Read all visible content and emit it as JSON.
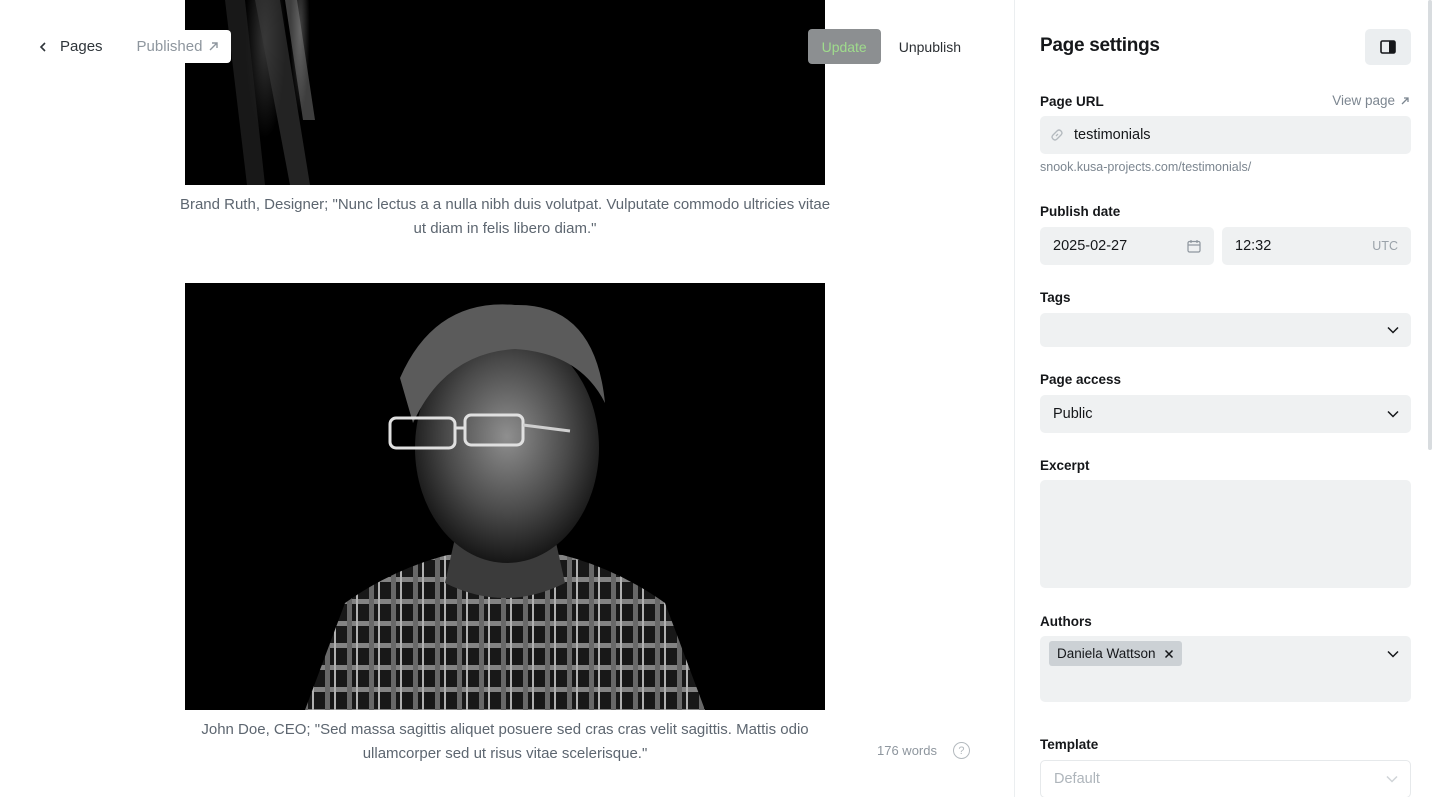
{
  "editor": {
    "back_label": "Pages",
    "status_label": "Published",
    "update_label": "Update",
    "unpublish_label": "Unpublish",
    "captions": [
      "Brand Ruth, Designer; \"Nunc lectus a a nulla nibh duis volutpat. Vulputate commodo ultricies vitae ut diam in felis libero diam.\"",
      "John Doe, CEO; \"Sed massa sagittis aliquet posuere sed cras cras velit sagittis. Mattis odio ullamcorper sed ut risus vitae scelerisque.\""
    ],
    "word_count": "176 words",
    "help_glyph": "?"
  },
  "settings": {
    "title": "Page settings",
    "url_label": "Page URL",
    "view_page_label": "View page",
    "url_value": "testimonials",
    "url_hint": "snook.kusa-projects.com/testimonials/",
    "publish_date_label": "Publish date",
    "date_value": "2025-02-27",
    "time_value": "12:32",
    "timezone": "UTC",
    "tags_label": "Tags",
    "tags_value": "",
    "access_label": "Page access",
    "access_value": "Public",
    "excerpt_label": "Excerpt",
    "excerpt_value": "",
    "authors_label": "Authors",
    "authors": [
      "Daniela Wattson"
    ],
    "template_label": "Template",
    "template_value": "Default"
  },
  "colors": {
    "field_bg": "#eff1f2",
    "update_text": "#9fdc8c",
    "muted_text": "#7c8690"
  },
  "icons": [
    "chevron-left-icon",
    "arrow-up-right-icon",
    "sidebar-toggle-icon",
    "link-icon",
    "calendar-icon",
    "chevron-down-icon",
    "close-icon",
    "help-icon"
  ]
}
